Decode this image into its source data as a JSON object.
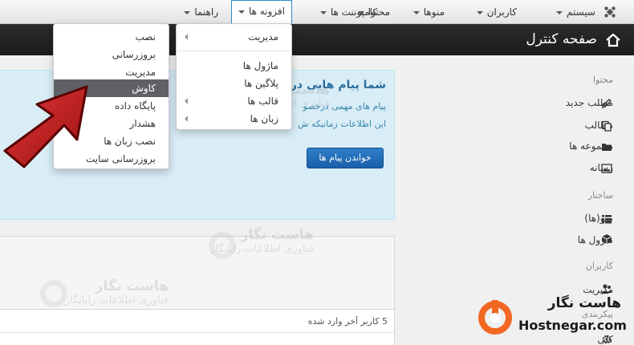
{
  "topbar": {
    "items": [
      {
        "label": "سیستم"
      },
      {
        "label": "کاربران"
      },
      {
        "label": "منوها"
      },
      {
        "label": "محتوا"
      },
      {
        "label": "کامپوننت ها"
      },
      {
        "label": "افزونه ها"
      },
      {
        "label": "راهنما"
      }
    ],
    "active_label": "افزونه ها"
  },
  "header": {
    "title": "صفحه کنترل"
  },
  "extensions_menu": {
    "items": [
      {
        "label": "مدیریت",
        "submenu": true
      },
      {
        "label": "ماژول ها",
        "submenu": false
      },
      {
        "label": "پلاگین ها",
        "submenu": false
      },
      {
        "label": "قالب ها",
        "submenu": true
      },
      {
        "label": "زبان ها",
        "submenu": true
      }
    ]
  },
  "manage_submenu": {
    "items": [
      {
        "label": "نصب"
      },
      {
        "label": "بروزرسانی"
      },
      {
        "label": "مدیریت"
      },
      {
        "label": "کاوش",
        "highlighted": true
      },
      {
        "label": "پایگاه داده"
      },
      {
        "label": "هشدار"
      },
      {
        "label": "نصب زبان ها"
      },
      {
        "label": "بروزرسانی سایت"
      }
    ]
  },
  "alert": {
    "title": "شما پیام هایی درخو",
    "line1": "پیام های مهمی درخصو",
    "line2": "این اطلاعات زمانیکه ش",
    "button": "خواندن پیام ها"
  },
  "users_panel": {
    "title": "5 کاربر آخر وارد شده"
  },
  "sidebar": {
    "content_heading": "محتوا",
    "content_items": [
      {
        "label": "مطلب جدید",
        "icon": "pencil-icon"
      },
      {
        "label": "مطالب",
        "icon": "copy-icon"
      },
      {
        "label": "مجموعه ها",
        "icon": "folder-icon"
      },
      {
        "label": "رسانه",
        "icon": "image-icon"
      }
    ],
    "structure_heading": "ساختار",
    "structure_items": [
      {
        "label": "منو(ها)",
        "icon": "list-icon"
      },
      {
        "label": "ماژول ها",
        "icon": "cube-icon"
      }
    ],
    "users_heading": "کاربران",
    "users_items": [
      {
        "label": "مدیریت",
        "icon": "users-icon"
      }
    ],
    "config_heading": "پیکربندی",
    "config_items": [
      {
        "label": "کلی",
        "icon": "gear-icon"
      }
    ]
  },
  "watermark": {
    "line1": "هاست نگار",
    "line2": "فناوری اطلاعات رایانگار"
  },
  "brand": {
    "name_fa": "هاست نگار",
    "name_en": "Hostnegar.com",
    "color": "#f26722"
  },
  "colors": {
    "arrow": "#c81a1a",
    "accent": "#2d8ac7",
    "titlebar": "#1f1f1f"
  }
}
